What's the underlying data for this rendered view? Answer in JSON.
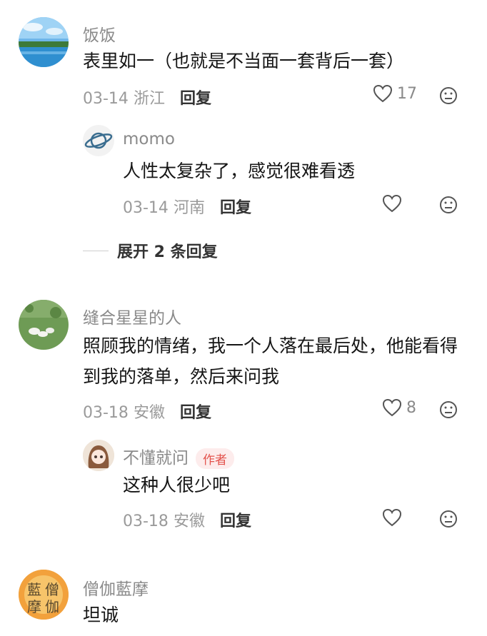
{
  "comments": [
    {
      "name": "饭饭",
      "text": "表里如一（也就是不当面一套背后一套）",
      "date": "03-14",
      "location": "浙江",
      "reply_label": "回复",
      "likes": "17",
      "replies": [
        {
          "name": "momo",
          "text": "人性太复杂了，感觉很难看透",
          "date": "03-14",
          "location": "河南",
          "reply_label": "回复"
        }
      ],
      "expand_label": "展开 2 条回复"
    },
    {
      "name": "缝合星星的人",
      "text": "照顾我的情绪，我一个人落在最后处，他能看得到我的落单，然后来问我",
      "date": "03-18",
      "location": "安徽",
      "reply_label": "回复",
      "likes": "8",
      "replies": [
        {
          "name": "不懂就问",
          "badge": "作者",
          "text": "这种人很少吧",
          "date": "03-18",
          "location": "安徽",
          "reply_label": "回复"
        }
      ]
    },
    {
      "name": "僧伽藍摩",
      "text": "坦诚",
      "avatar_text": [
        "藍",
        "僧",
        "摩",
        "伽"
      ]
    }
  ],
  "colors": {
    "author_badge": "#e3524c",
    "muted": "#8a8a8a"
  },
  "icons": [
    "heart-icon",
    "emoji-reaction-icon",
    "planet-icon"
  ]
}
